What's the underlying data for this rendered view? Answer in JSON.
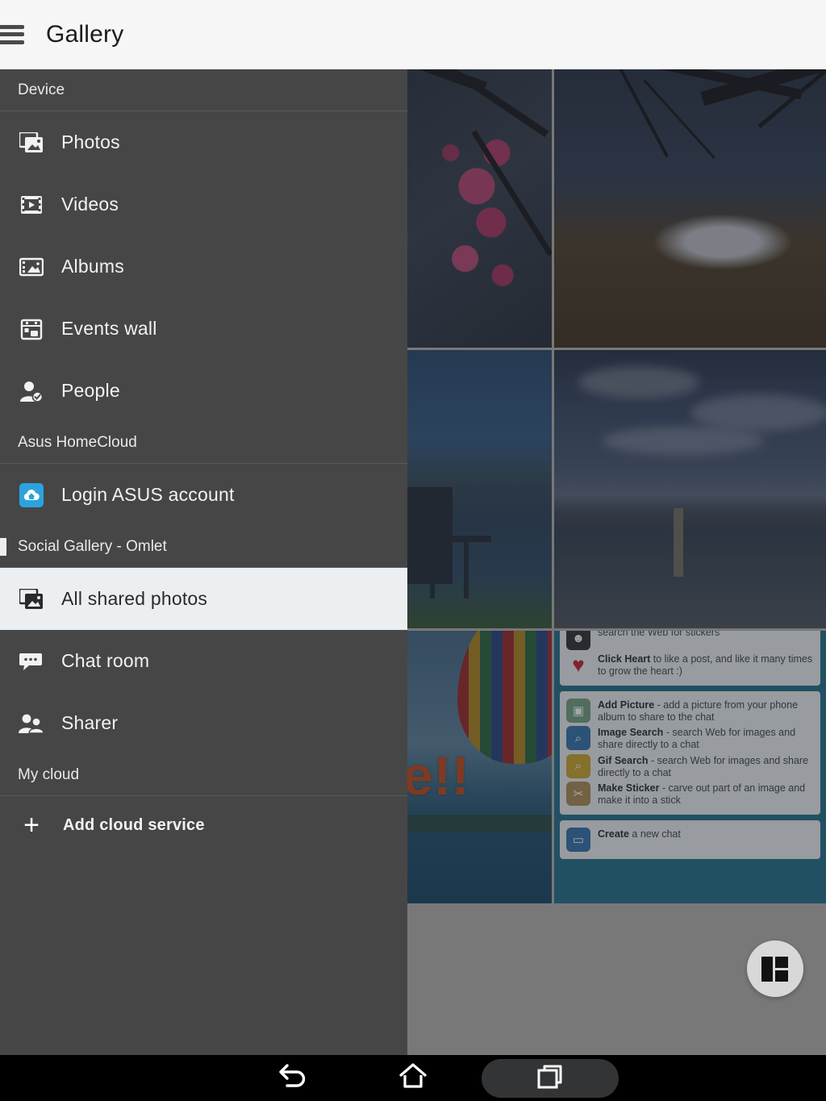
{
  "app": {
    "title": "Gallery",
    "menu_icon": "hamburger-icon"
  },
  "drawer": {
    "sections": [
      {
        "header": "Device",
        "items": [
          {
            "label": "Photos",
            "icon": "photos-icon",
            "active": false
          },
          {
            "label": "Videos",
            "icon": "videos-icon",
            "active": false
          },
          {
            "label": "Albums",
            "icon": "albums-icon",
            "active": false
          },
          {
            "label": "Events wall",
            "icon": "calendar-icon",
            "active": false
          },
          {
            "label": "People",
            "icon": "person-check-icon",
            "active": false
          }
        ]
      },
      {
        "header": "Asus HomeCloud",
        "items": [
          {
            "label": "Login ASUS account",
            "icon": "asus-cloud-icon",
            "active": false
          }
        ]
      },
      {
        "header": "Social Gallery - Omlet",
        "marked": true,
        "items": [
          {
            "label": "All shared photos",
            "icon": "photos-icon",
            "active": true
          },
          {
            "label": "Chat room",
            "icon": "chat-icon",
            "active": false
          },
          {
            "label": "Sharer",
            "icon": "people-icon",
            "active": false
          }
        ]
      },
      {
        "header": "My cloud",
        "items": [
          {
            "label": "Add cloud service",
            "icon": "plus-icon",
            "active": false
          }
        ]
      }
    ]
  },
  "gallery": {
    "rows": [
      {
        "cells": [
          {
            "name": "photo-blossom",
            "alt": "Pink plum blossoms on a branch"
          },
          {
            "name": "photo-mount-fuji",
            "alt": "Mount Fuji seen through bare branches"
          }
        ]
      },
      {
        "cells": [
          {
            "name": "photo-lake-hut",
            "alt": "Boat hut on a calm blue lake"
          },
          {
            "name": "photo-lake-tekapo",
            "alt": "Lake with wooden post and snowy mountains"
          }
        ]
      },
      {
        "cells": [
          {
            "name": "photo-hot-air-balloon",
            "alt": "Colourful hot air balloon over the sea",
            "overlay_text": "e!!"
          },
          {
            "name": "photo-omlet-tutorial",
            "alt": "Omlet chat tutorial screenshot"
          }
        ]
      }
    ]
  },
  "tutorial": {
    "cards": [
      {
        "rows": [
          {
            "icon": "sticker-icon",
            "bold": "",
            "text": "search the Web for stickers"
          },
          {
            "icon": "heart-icon",
            "bold": "Click Heart",
            "text": " to like a post, and like it many times to grow the heart :)"
          }
        ]
      },
      {
        "rows": [
          {
            "icon": "add-picture-icon",
            "bold": "Add Picture",
            "text": " - add a picture from your phone album to share to the chat"
          },
          {
            "icon": "image-search-icon",
            "bold": "Image Search",
            "text": " - search Web for images and share directly to a chat"
          },
          {
            "icon": "gif-search-icon",
            "bold": "Gif Search",
            "text": " - search Web for images and share directly to a chat"
          },
          {
            "icon": "make-sticker-icon",
            "bold": "Make Sticker",
            "text": " - carve out part of an image and make it into a stick"
          }
        ]
      },
      {
        "rows": [
          {
            "icon": "new-chat-icon",
            "bold": "Create",
            "text": " a new chat"
          }
        ]
      }
    ]
  },
  "fab": {
    "icon": "layout-grid-icon",
    "label": "Change layout"
  },
  "navbar": {
    "buttons": [
      {
        "name": "back",
        "icon": "back-arrow-icon",
        "active": false
      },
      {
        "name": "home",
        "icon": "home-icon",
        "active": false
      },
      {
        "name": "recents",
        "icon": "recents-icon",
        "active": true
      }
    ]
  },
  "colors": {
    "header_bg": "#f6f6f6",
    "drawer_bg": "#464646",
    "drawer_active_bg": "#eceff1",
    "content_bg": "#787878",
    "accent_blue": "#2ba3de",
    "navbar_bg": "#000000"
  }
}
